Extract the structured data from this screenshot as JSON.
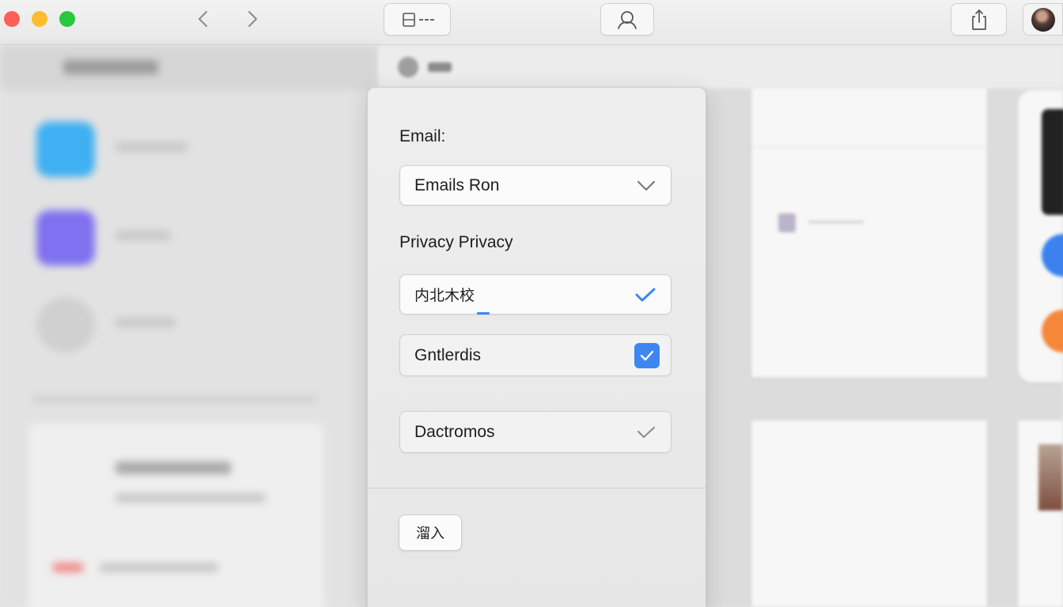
{
  "form": {
    "email_label": "Email:",
    "email_value": "Emails Ron",
    "privacy_label": "Privacy Privacy",
    "options": [
      {
        "label": "内北木校",
        "state": "checked-checkmark",
        "check_color": "#3b87f5"
      },
      {
        "label": "Gntlerdis",
        "state": "checked-checkbox",
        "check_color": "#3e86f0"
      },
      {
        "label": "Dactromos",
        "state": "unchecked-checkmark",
        "check_color": "#8e8e8e"
      }
    ],
    "footer_button_label": "溜入"
  },
  "toolbar": {
    "icons": [
      "chevron-left-icon",
      "chevron-right-icon",
      "sidebar-icon",
      "account-icon",
      "share-icon"
    ]
  },
  "colors": {
    "close": "#fe5f57",
    "minimize": "#febc2e",
    "zoom": "#28c840",
    "accent": "#3e86f0"
  }
}
